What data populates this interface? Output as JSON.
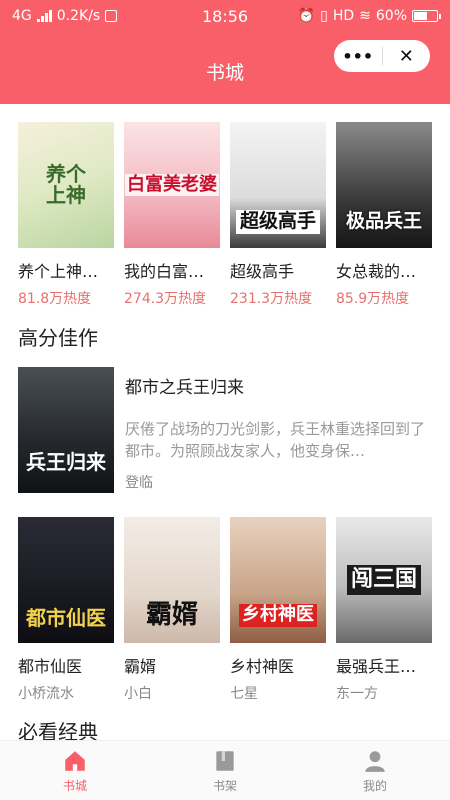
{
  "status_bar": {
    "network": "4G",
    "speed": "0.2K/s",
    "time": "18:56",
    "hd": "HD",
    "battery": "60%"
  },
  "header": {
    "title": "书城",
    "more_icon": "more-dots-icon",
    "close_icon": "close-icon"
  },
  "top_books": [
    {
      "name": "养个上神…",
      "heat": "81.8万热度",
      "cover_text": "养个上神"
    },
    {
      "name": "我的白富…",
      "heat": "274.3万热度",
      "cover_text": "白富美老婆"
    },
    {
      "name": "超级高手",
      "heat": "231.3万热度",
      "cover_text": "超级高手"
    },
    {
      "name": "女总裁的…",
      "heat": "85.9万热度",
      "cover_text": "极品兵王"
    }
  ],
  "high_score": {
    "heading": "高分佳作",
    "title": "都市之兵王归来",
    "description": "厌倦了战场的刀光剑影，兵王林重选择回到了都市。为照顾战友家人，他变身保…",
    "author": "登临",
    "cover_text": "兵王归来"
  },
  "second_books": [
    {
      "name": "都市仙医",
      "author": "小桥流水",
      "cover_text": "都市仙医"
    },
    {
      "name": "霸婿",
      "author": "小白",
      "cover_text": "霸婿"
    },
    {
      "name": "乡村神医",
      "author": "七星",
      "cover_text": "乡村神医"
    },
    {
      "name": "最强兵王…",
      "author": "东一方",
      "cover_text": "闯三国"
    }
  ],
  "must_read": {
    "heading": "必看经典"
  },
  "tabbar": {
    "items": [
      {
        "label": "书城",
        "icon": "home-icon",
        "active": true
      },
      {
        "label": "书架",
        "icon": "bookshelf-icon",
        "active": false
      },
      {
        "label": "我的",
        "icon": "user-icon",
        "active": false
      }
    ]
  },
  "colors": {
    "accent": "#f95f68",
    "heat": "#e9706d",
    "muted": "#888888"
  }
}
